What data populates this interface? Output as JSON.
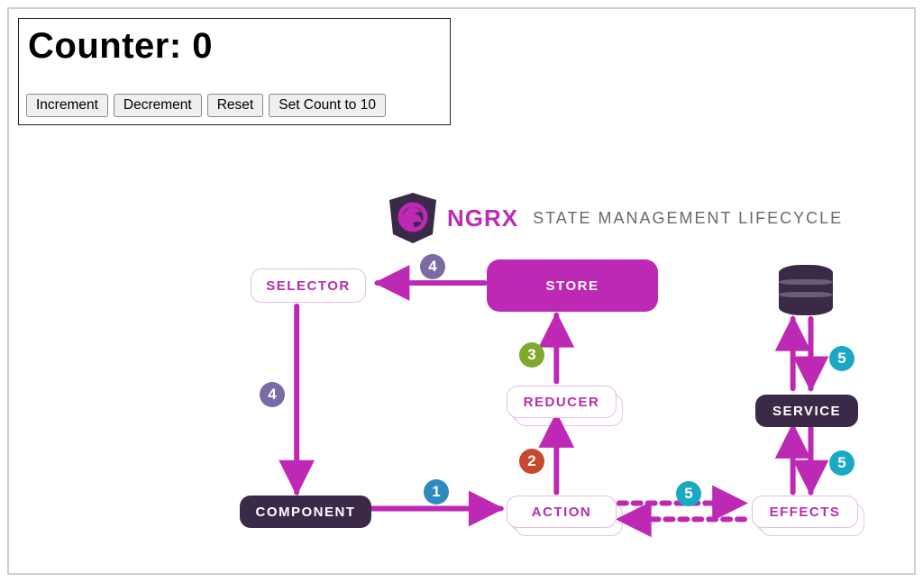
{
  "counter": {
    "title_prefix": "Counter: ",
    "value": "0",
    "buttons": {
      "increment": "Increment",
      "decrement": "Decrement",
      "reset": "Reset",
      "setcount": "Set Count to 10"
    }
  },
  "diagram": {
    "brand": "NGRX",
    "subtitle": "STATE MANAGEMENT LIFECYCLE",
    "nodes": {
      "selector": "SELECTOR",
      "store": "STORE",
      "reducer": "REDUCER",
      "component": "COMPONENT",
      "action": "ACTION",
      "effects": "EFFECTS",
      "service": "SERVICE"
    },
    "steps": {
      "s1": "1",
      "s2": "2",
      "s3": "3",
      "s4a": "4",
      "s4b": "4",
      "s5a": "5",
      "s5b": "5",
      "s5c": "5"
    },
    "colors": {
      "brand": "#bd28b5",
      "dark": "#3a2a47",
      "outline": "#e6bfe3"
    }
  }
}
